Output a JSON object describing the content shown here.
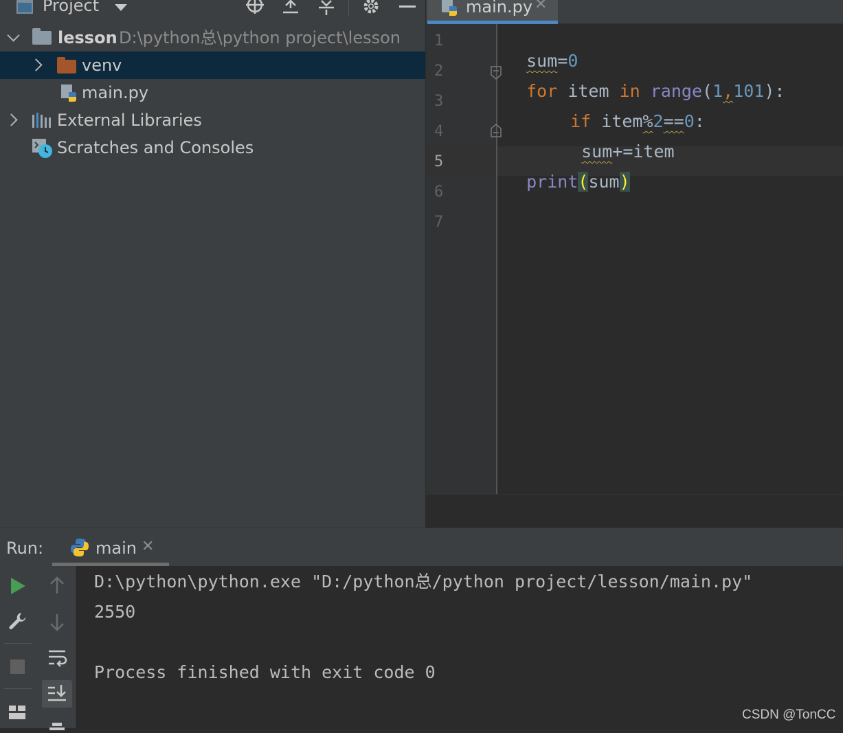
{
  "project_panel": {
    "title": "Project",
    "tree": {
      "root": {
        "name": "lesson",
        "path": "D:\\python总\\python project\\lesson"
      },
      "venv": "venv",
      "main_file": "main.py",
      "external_libraries": "External Libraries",
      "scratches": "Scratches and Consoles"
    }
  },
  "editor": {
    "tab_label": "main.py",
    "line_numbers": [
      "1",
      "2",
      "3",
      "4",
      "5",
      "6",
      "7"
    ],
    "current_line": "5"
  },
  "code": {
    "l1": {
      "a": "sum",
      "b": "=",
      "c": "0"
    },
    "l2": {
      "kw1": "for",
      "id1": " item ",
      "kw2": "in",
      "sp": " ",
      "fn": "range",
      "p1": "(",
      "n1": "1",
      "comma": ",",
      "n2": "101",
      "p2": "):"
    },
    "l3": {
      "kw": "if",
      "id": " item",
      "op": "%",
      "n1": "2",
      "eq": "==",
      "n2": "0",
      "colon": ":"
    },
    "l4": {
      "a": "sum",
      "b": "+=item"
    },
    "l5": {
      "fn": "print",
      "p1": "(",
      "arg": "sum",
      "p2": ")"
    }
  },
  "run": {
    "label": "Run:",
    "tab_label": "main",
    "output": [
      "D:\\python\\python.exe \"D:/python总/python project/lesson/main.py\"",
      "2550",
      "",
      "Process finished with exit code 0"
    ]
  },
  "watermark": "CSDN @TonCC",
  "colors": {
    "accent": "#4a88c7",
    "keyword": "#cc7832",
    "number": "#6897bb",
    "builtin": "#8888c6",
    "selection": "#0d293e",
    "run_green": "#499c54"
  }
}
